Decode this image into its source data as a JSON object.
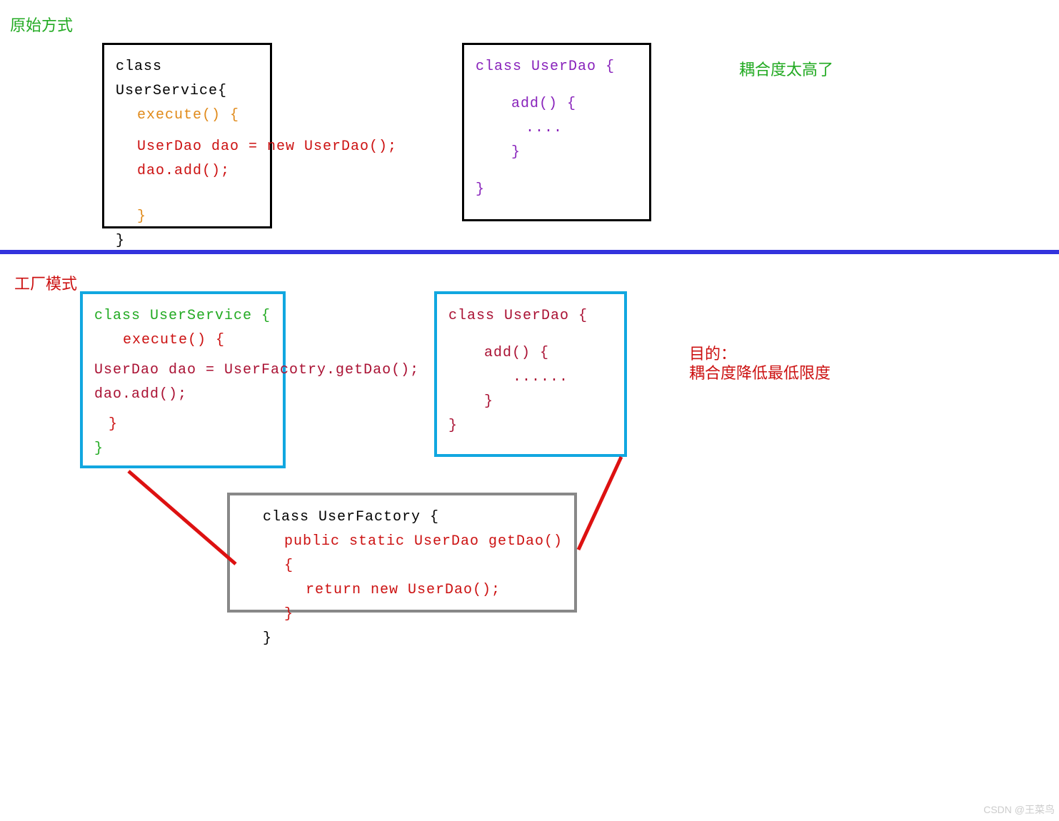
{
  "section1": {
    "title": "原始方式",
    "note": "耦合度太高了",
    "userService": {
      "line1": "class UserService{",
      "line2": "execute() {",
      "line3": "UserDao dao = new UserDao();",
      "line3a": "UserDao dao = ne",
      "line3b": "w UserDao();",
      "line4": "dao.add();",
      "line5": "}",
      "line6": "}"
    },
    "userDao": {
      "line1": "class UserDao {",
      "line2": "add() {",
      "line3": "....",
      "line4": "}",
      "line5": "}"
    }
  },
  "section2": {
    "title": "工厂模式",
    "note1": "目的：",
    "note2": "耦合度降低最低限度",
    "userService": {
      "line1": "class UserService {",
      "line2": "execute() {",
      "line3": "UserDao dao = UserFacotry.getDao();",
      "line3a": "UserDao dao = UserFa",
      "line3b": "cotry.getDao();",
      "line4": "dao.add();",
      "line5": "}",
      "line6": "}"
    },
    "userDao": {
      "line1": "class UserDao {",
      "line2": "add() {",
      "line3": "......",
      "line4": "}",
      "line5": "}"
    },
    "userFactory": {
      "line1": "class UserFactory {",
      "line2": "public static UserDao getDao() {",
      "line3": "return new UserDao();",
      "line4": "}",
      "line5": "}"
    }
  },
  "watermark": "CSDN @王菜鸟"
}
